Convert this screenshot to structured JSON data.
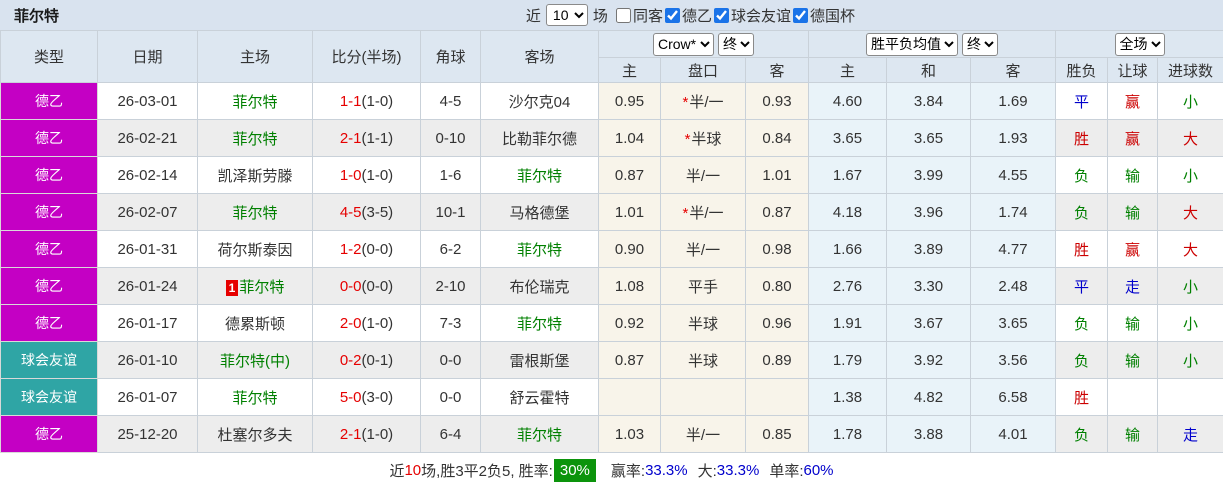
{
  "header": {
    "title": "菲尔特",
    "near_label": "近",
    "match_count": "10",
    "matches_label": "场",
    "filters": [
      {
        "label": "同客",
        "checked": false
      },
      {
        "label": "德乙",
        "checked": true
      },
      {
        "label": "球会友谊",
        "checked": true
      },
      {
        "label": "德国杯",
        "checked": true
      }
    ]
  },
  "table": {
    "main_columns": [
      "类型",
      "日期",
      "主场",
      "比分(半场)",
      "角球",
      "客场"
    ],
    "selects": {
      "company": "Crow*",
      "company_state": "终",
      "average": "胜平负均值",
      "average_state": "终",
      "scope": "全场"
    },
    "sub_columns": [
      "主",
      "盘口",
      "客",
      "主",
      "和",
      "客",
      "胜负",
      "让球",
      "进球数"
    ],
    "rows": [
      {
        "type": "德乙",
        "type_class": "l2",
        "date": "26-03-01",
        "home": "菲尔特",
        "home_self": true,
        "home_badge": "",
        "score": "1-1",
        "half": "(1-0)",
        "corners": "4-5",
        "away": "沙尔克04",
        "away_self": false,
        "star": true,
        "odds_home": "0.95",
        "handicap": "半/一",
        "odds_away": "0.93",
        "avg_home": "4.60",
        "avg_draw": "3.84",
        "avg_away": "1.69",
        "result": {
          "t": "平",
          "c": "blue"
        },
        "handicap_result": {
          "t": "赢",
          "c": "red"
        },
        "goals_result": {
          "t": "小",
          "c": "green"
        }
      },
      {
        "type": "德乙",
        "type_class": "l2",
        "date": "26-02-21",
        "home": "菲尔特",
        "home_self": true,
        "home_badge": "",
        "score": "2-1",
        "half": "(1-1)",
        "corners": "0-10",
        "away": "比勒菲尔德",
        "away_self": false,
        "star": true,
        "odds_home": "1.04",
        "handicap": "半球",
        "odds_away": "0.84",
        "avg_home": "3.65",
        "avg_draw": "3.65",
        "avg_away": "1.93",
        "result": {
          "t": "胜",
          "c": "red"
        },
        "handicap_result": {
          "t": "赢",
          "c": "red"
        },
        "goals_result": {
          "t": "大",
          "c": "red"
        }
      },
      {
        "type": "德乙",
        "type_class": "l2",
        "date": "26-02-14",
        "home": "凯泽斯劳滕",
        "home_self": false,
        "home_badge": "",
        "score": "1-0",
        "half": "(1-0)",
        "corners": "1-6",
        "away": "菲尔特",
        "away_self": true,
        "star": false,
        "odds_home": "0.87",
        "handicap": "半/一",
        "odds_away": "1.01",
        "avg_home": "1.67",
        "avg_draw": "3.99",
        "avg_away": "4.55",
        "result": {
          "t": "负",
          "c": "green"
        },
        "handicap_result": {
          "t": "输",
          "c": "green"
        },
        "goals_result": {
          "t": "小",
          "c": "green"
        }
      },
      {
        "type": "德乙",
        "type_class": "l2",
        "date": "26-02-07",
        "home": "菲尔特",
        "home_self": true,
        "home_badge": "",
        "score": "4-5",
        "half": "(3-5)",
        "corners": "10-1",
        "away": "马格德堡",
        "away_self": false,
        "star": true,
        "odds_home": "1.01",
        "handicap": "半/一",
        "odds_away": "0.87",
        "avg_home": "4.18",
        "avg_draw": "3.96",
        "avg_away": "1.74",
        "result": {
          "t": "负",
          "c": "green"
        },
        "handicap_result": {
          "t": "输",
          "c": "green"
        },
        "goals_result": {
          "t": "大",
          "c": "red"
        }
      },
      {
        "type": "德乙",
        "type_class": "l2",
        "date": "26-01-31",
        "home": "荷尔斯泰因",
        "home_self": false,
        "home_badge": "",
        "score": "1-2",
        "half": "(0-0)",
        "corners": "6-2",
        "away": "菲尔特",
        "away_self": true,
        "star": false,
        "odds_home": "0.90",
        "handicap": "半/一",
        "odds_away": "0.98",
        "avg_home": "1.66",
        "avg_draw": "3.89",
        "avg_away": "4.77",
        "result": {
          "t": "胜",
          "c": "red"
        },
        "handicap_result": {
          "t": "赢",
          "c": "red"
        },
        "goals_result": {
          "t": "大",
          "c": "red"
        }
      },
      {
        "type": "德乙",
        "type_class": "l2",
        "date": "26-01-24",
        "home": "菲尔特",
        "home_self": true,
        "home_badge": "1",
        "score": "0-0",
        "half": "(0-0)",
        "corners": "2-10",
        "away": "布伦瑞克",
        "away_self": false,
        "star": false,
        "odds_home": "1.08",
        "handicap": "平手",
        "odds_away": "0.80",
        "avg_home": "2.76",
        "avg_draw": "3.30",
        "avg_away": "2.48",
        "result": {
          "t": "平",
          "c": "blue"
        },
        "handicap_result": {
          "t": "走",
          "c": "blue"
        },
        "goals_result": {
          "t": "小",
          "c": "green"
        }
      },
      {
        "type": "德乙",
        "type_class": "l2",
        "date": "26-01-17",
        "home": "德累斯顿",
        "home_self": false,
        "home_badge": "",
        "score": "2-0",
        "half": "(1-0)",
        "corners": "7-3",
        "away": "菲尔特",
        "away_self": true,
        "star": false,
        "odds_home": "0.92",
        "handicap": "半球",
        "odds_away": "0.96",
        "avg_home": "1.91",
        "avg_draw": "3.67",
        "avg_away": "3.65",
        "result": {
          "t": "负",
          "c": "green"
        },
        "handicap_result": {
          "t": "输",
          "c": "green"
        },
        "goals_result": {
          "t": "小",
          "c": "green"
        }
      },
      {
        "type": "球会友谊",
        "type_class": "friendly",
        "date": "26-01-10",
        "home": "菲尔特(中)",
        "home_self": true,
        "home_badge": "",
        "score": "0-2",
        "half": "(0-1)",
        "corners": "0-0",
        "away": "雷根斯堡",
        "away_self": false,
        "star": false,
        "odds_home": "0.87",
        "handicap": "半球",
        "odds_away": "0.89",
        "avg_home": "1.79",
        "avg_draw": "3.92",
        "avg_away": "3.56",
        "result": {
          "t": "负",
          "c": "green"
        },
        "handicap_result": {
          "t": "输",
          "c": "green"
        },
        "goals_result": {
          "t": "小",
          "c": "green"
        }
      },
      {
        "type": "球会友谊",
        "type_class": "friendly",
        "date": "26-01-07",
        "home": "菲尔特",
        "home_self": true,
        "home_badge": "",
        "score": "5-0",
        "half": "(3-0)",
        "corners": "0-0",
        "away": "舒云霍特",
        "away_self": false,
        "star": false,
        "odds_home": "",
        "handicap": "",
        "odds_away": "",
        "avg_home": "1.38",
        "avg_draw": "4.82",
        "avg_away": "6.58",
        "result": {
          "t": "胜",
          "c": "red"
        },
        "handicap_result": {
          "t": "",
          "c": ""
        },
        "goals_result": {
          "t": "",
          "c": ""
        }
      },
      {
        "type": "德乙",
        "type_class": "l2",
        "date": "25-12-20",
        "home": "杜塞尔多夫",
        "home_self": false,
        "home_badge": "",
        "score": "2-1",
        "half": "(1-0)",
        "corners": "6-4",
        "away": "菲尔特",
        "away_self": true,
        "star": false,
        "odds_home": "1.03",
        "handicap": "半/一",
        "odds_away": "0.85",
        "avg_home": "1.78",
        "avg_draw": "3.88",
        "avg_away": "4.01",
        "result": {
          "t": "负",
          "c": "green"
        },
        "handicap_result": {
          "t": "输",
          "c": "green"
        },
        "goals_result": {
          "t": "走",
          "c": "blue"
        }
      }
    ]
  },
  "footer": {
    "prefix": "近",
    "count": "10",
    "mid": "场,胜3平2负5, 胜率:",
    "win_rate": "30%",
    "seg2_label": "赢率:",
    "seg2_value": "33.3%",
    "seg3_label": "大:",
    "seg3_value": "33.3%",
    "seg4_label": "单率:",
    "seg4_value": "60%"
  }
}
